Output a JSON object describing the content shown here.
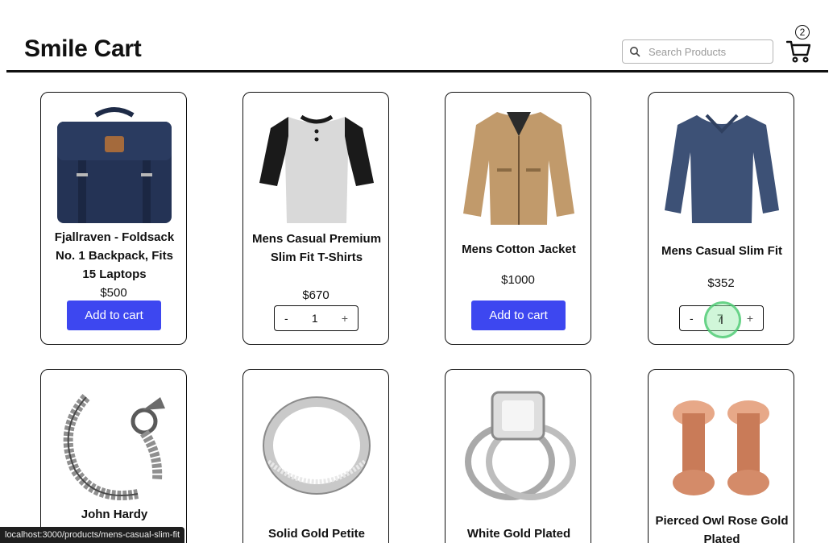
{
  "header": {
    "brand": "Smile Cart",
    "search_placeholder": "Search Products",
    "cart_count": "2"
  },
  "products": [
    {
      "name": "Fjallraven - Foldsack No. 1 Backpack, Fits 15 Laptops",
      "price": "$500",
      "action": "Add to cart"
    },
    {
      "name": "Mens Casual Premium Slim Fit T-Shirts",
      "price": "$670",
      "quantity": "1",
      "minus": "-",
      "plus": "+"
    },
    {
      "name": "Mens Cotton Jacket",
      "price": "$1000",
      "action": "Add to cart"
    },
    {
      "name": "Mens Casual Slim Fit",
      "price": "$352",
      "quantity": "7",
      "minus": "-",
      "plus": "+"
    },
    {
      "name": "John Hardy"
    },
    {
      "name": "Solid Gold Petite"
    },
    {
      "name": "White Gold Plated"
    },
    {
      "name": "Pierced Owl Rose Gold Plated"
    }
  ],
  "status_url": "localhost:3000/products/mens-casual-slim-fit",
  "colors": {
    "primary": "#3d47f0",
    "text": "#111111",
    "border": "#111111",
    "focus_ring": "#46c86e"
  }
}
